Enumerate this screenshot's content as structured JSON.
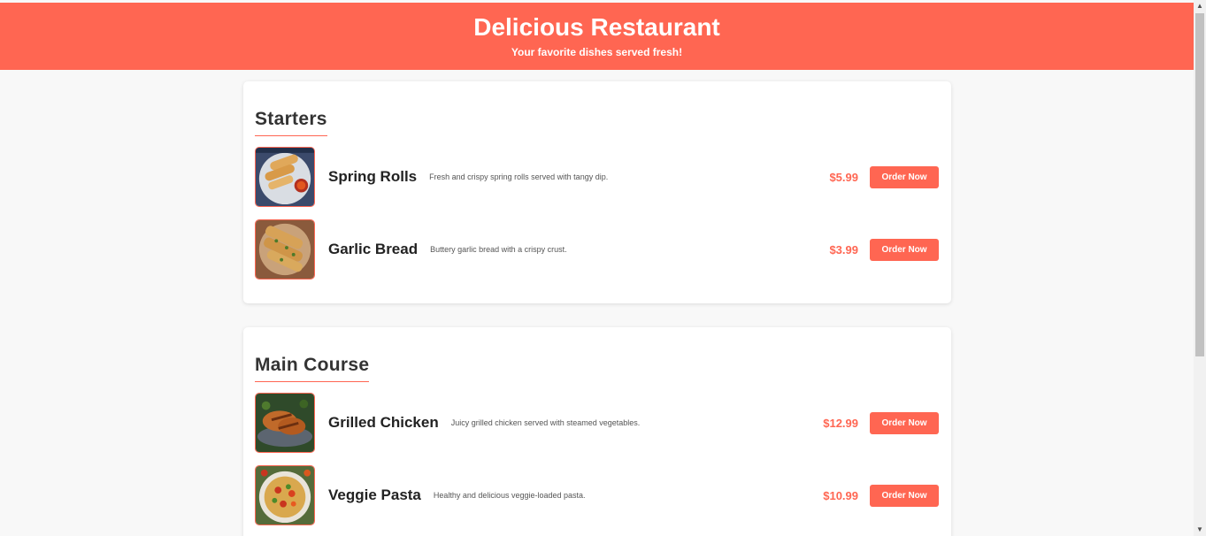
{
  "header": {
    "title": "Delicious Restaurant",
    "subtitle": "Your favorite dishes served fresh!"
  },
  "sections": [
    {
      "heading": "Starters",
      "items": [
        {
          "name": "Spring Rolls",
          "description": "Fresh and crispy spring rolls served with tangy dip.",
          "price": "$5.99",
          "button": "Order Now",
          "image": "spring-rolls-image"
        },
        {
          "name": "Garlic Bread",
          "description": "Buttery garlic bread with a crispy crust.",
          "price": "$3.99",
          "button": "Order Now",
          "image": "garlic-bread-image"
        }
      ]
    },
    {
      "heading": "Main Course",
      "items": [
        {
          "name": "Grilled Chicken",
          "description": "Juicy grilled chicken served with steamed vegetables.",
          "price": "$12.99",
          "button": "Order Now",
          "image": "grilled-chicken-image"
        },
        {
          "name": "Veggie Pasta",
          "description": "Healthy and delicious veggie-loaded pasta.",
          "price": "$10.99",
          "button": "Order Now",
          "image": "veggie-pasta-image"
        }
      ]
    }
  ],
  "colors": {
    "accent": "#ff6652",
    "background": "#f8f8f8",
    "card": "#ffffff",
    "heading_text": "#333333"
  },
  "scrollbar": {
    "up_icon": "chevron-up-icon",
    "down_icon": "chevron-down-icon"
  }
}
